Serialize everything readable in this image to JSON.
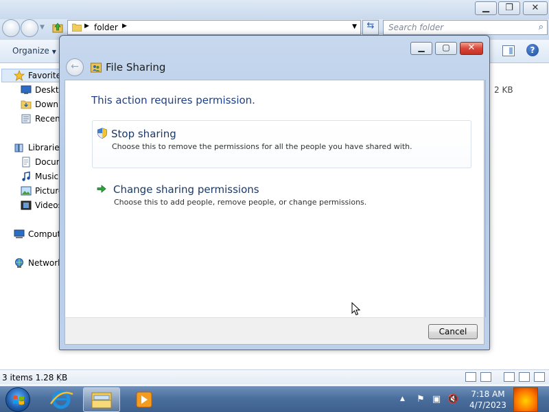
{
  "explorer": {
    "breadcrumb": {
      "folder": "folder"
    },
    "search_placeholder": "Search folder",
    "toolbar": {
      "organize_label": "Organize"
    },
    "nav": {
      "favorites": "Favorites",
      "desktop": "Deskto",
      "downloads": "Downl",
      "recent": "Recent",
      "libraries": "Libraries",
      "documents": "Docum",
      "music": "Music",
      "pictures": "Picture",
      "videos": "Videos",
      "computer": "Comput",
      "network": "Network"
    },
    "size_column_value": "2 KB",
    "status": {
      "summary": "3 items  1.28 KB"
    }
  },
  "dialog": {
    "title": "File Sharing",
    "heading": "This action requires permission.",
    "options": [
      {
        "title": "Stop sharing",
        "description": "Choose this to remove the permissions for all the people you have shared with.",
        "icon": "uac-shield-icon"
      },
      {
        "title": "Change sharing permissions",
        "description": "Choose this to add people, remove people, or change permissions.",
        "icon": "green-arrow-icon"
      }
    ],
    "cancel_label": "Cancel"
  },
  "taskbar": {
    "clock_time": "7:18 AM",
    "clock_date": "4/7/2023"
  },
  "colors": {
    "heading_blue": "#1d3f8a",
    "taskbar": "#4b6f9e",
    "close_red": "#d9463a"
  }
}
